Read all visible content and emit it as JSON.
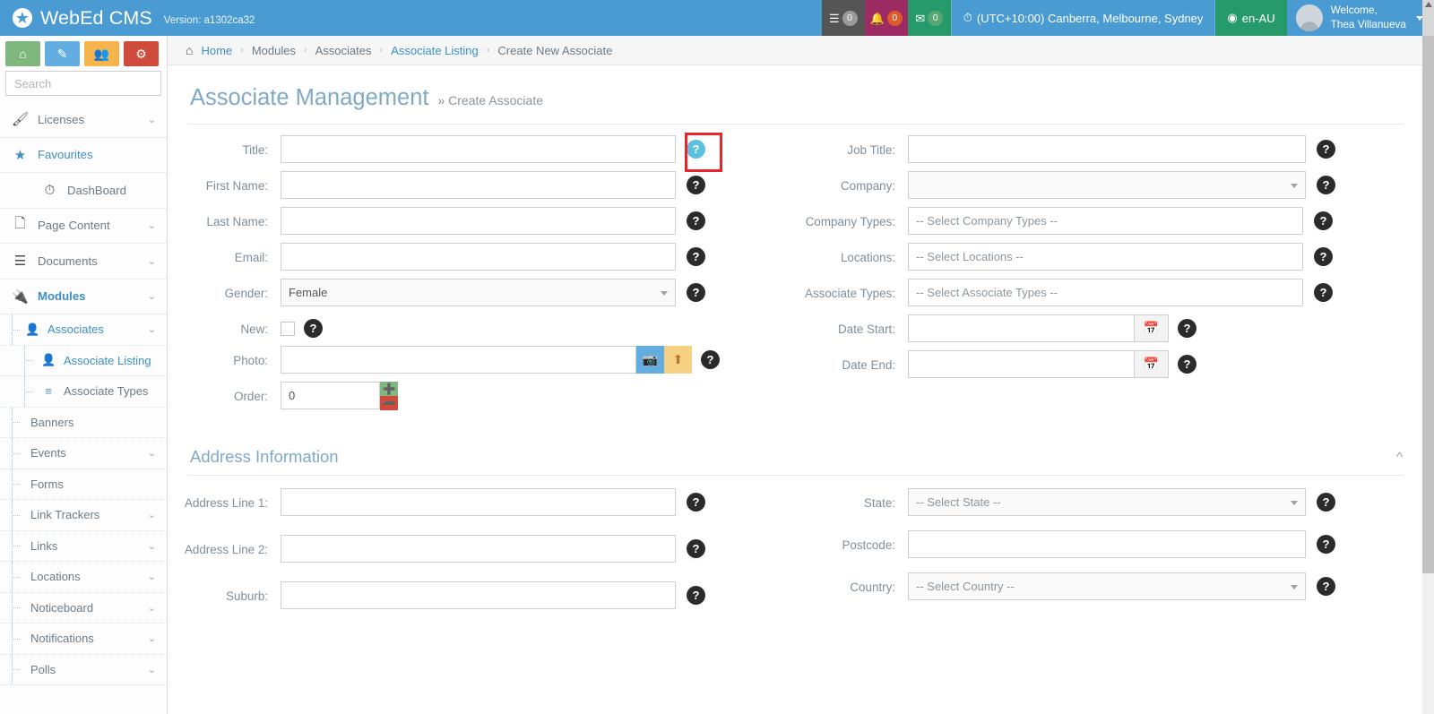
{
  "header": {
    "brand_name": "WebEd CMS",
    "brand_icon": "globe-icon",
    "version": "Version: a1302ca32",
    "tiles": [
      {
        "icon": "tasks-icon",
        "count": "0",
        "color": "#555555",
        "badge_color": "#9b9b9b"
      },
      {
        "icon": "bell-icon",
        "count": "0",
        "color": "#9c2a63",
        "badge_color": "#e0592a"
      },
      {
        "icon": "envelope-icon",
        "count": "0",
        "color": "#279a6c",
        "badge_color": "#57a773"
      }
    ],
    "timezone": "(UTC+10:00) Canberra, Melbourne, Sydney",
    "timezone_icon": "clock-icon",
    "language": "en-AU",
    "language_icon": "globe-small-icon",
    "welcome_line1": "Welcome,",
    "welcome_line2": "Thea Villanueva"
  },
  "sidebar": {
    "quick_actions": [
      {
        "name": "home",
        "icon": "home-icon",
        "color": "#7fb77e"
      },
      {
        "name": "edit",
        "icon": "pencil-icon",
        "color": "#63ade0"
      },
      {
        "name": "users",
        "icon": "users-icon",
        "color": "#f5b44c"
      },
      {
        "name": "settings",
        "icon": "gears-icon",
        "color": "#cf4b3c"
      }
    ],
    "search_placeholder": "Search",
    "search_value": "",
    "search_icon": "search-icon",
    "items": [
      {
        "label": "Licenses",
        "icon": "brush-icon",
        "chevron": "⌄",
        "style": "plain"
      },
      {
        "label": "Favourites",
        "icon": "star-icon",
        "chevron": "",
        "style": "blue"
      },
      {
        "label": "DashBoard",
        "icon": "gauge-icon",
        "chevron": "",
        "style": "plain"
      },
      {
        "label": "Page Content",
        "icon": "document-icon",
        "chevron": "⌄",
        "style": "plain"
      },
      {
        "label": "Documents",
        "icon": "lines-icon",
        "chevron": "⌄",
        "style": "plain"
      },
      {
        "label": "Modules",
        "icon": "plug-icon",
        "chevron": "⌄",
        "style": "blue-bold"
      }
    ],
    "sub_items": [
      {
        "label": "Associates",
        "icon": "associate-icon",
        "chevron": "⌄",
        "level": 1,
        "active": true
      },
      {
        "label": "Associate Listing",
        "icon": "associate-icon",
        "chevron": "",
        "level": 2,
        "active": true
      },
      {
        "label": "Associate Types",
        "icon": "list-icon",
        "chevron": "",
        "level": 2,
        "active": false
      },
      {
        "label": "Banners",
        "icon": "",
        "chevron": "",
        "level": 1,
        "active": false
      },
      {
        "label": "Events",
        "icon": "",
        "chevron": "⌄",
        "level": 1,
        "active": false
      },
      {
        "label": "Forms",
        "icon": "",
        "chevron": "",
        "level": 1,
        "active": false
      },
      {
        "label": "Link Trackers",
        "icon": "",
        "chevron": "⌄",
        "level": 1,
        "active": false
      },
      {
        "label": "Links",
        "icon": "",
        "chevron": "⌄",
        "level": 1,
        "active": false
      },
      {
        "label": "Locations",
        "icon": "",
        "chevron": "⌄",
        "level": 1,
        "active": false
      },
      {
        "label": "Noticeboard",
        "icon": "",
        "chevron": "⌄",
        "level": 1,
        "active": false
      },
      {
        "label": "Notifications",
        "icon": "",
        "chevron": "⌄",
        "level": 1,
        "active": false
      },
      {
        "label": "Polls",
        "icon": "",
        "chevron": "⌄",
        "level": 1,
        "active": false
      }
    ]
  },
  "breadcrumb": {
    "home_icon": "home-icon",
    "items": [
      {
        "label": "Home",
        "link": true
      },
      {
        "label": "Modules",
        "link": false
      },
      {
        "label": "Associates",
        "link": false
      },
      {
        "label": "Associate Listing",
        "link": true
      },
      {
        "label": "Create New Associate",
        "link": false
      }
    ],
    "separator": "›"
  },
  "page": {
    "title": "Associate Management",
    "subtitle": "» Create Associate"
  },
  "form": {
    "help_icon": "question-mark-icon",
    "left": [
      {
        "label": "Title:",
        "type": "text",
        "value": "",
        "placeholder": "",
        "width": "w441",
        "help": true,
        "highlighted": true
      },
      {
        "label": "First Name:",
        "type": "text",
        "value": "",
        "placeholder": "",
        "width": "w441",
        "help": true,
        "highlighted": false
      },
      {
        "label": "Last Name:",
        "type": "text",
        "value": "",
        "placeholder": "",
        "width": "w441",
        "help": true,
        "highlighted": false
      },
      {
        "label": "Email:",
        "type": "text",
        "value": "",
        "placeholder": "",
        "width": "w441",
        "help": true,
        "highlighted": false
      },
      {
        "label": "Gender:",
        "type": "select",
        "value": "Female",
        "width": "w441",
        "help": true,
        "highlighted": false
      },
      {
        "label": "New:",
        "type": "checkbox",
        "checked": false,
        "help": true,
        "highlighted": false
      },
      {
        "label": "Photo:",
        "type": "photo",
        "value": "",
        "width": "w397",
        "help": true,
        "highlighted": false,
        "browse_icon": "image-icon",
        "upload_icon": "upload-icon"
      },
      {
        "label": "Order:",
        "type": "stepper",
        "value": "0",
        "width": "w111",
        "help": false,
        "highlighted": false,
        "plus": "+",
        "minus": "−"
      }
    ],
    "right": [
      {
        "label": "Job Title:",
        "type": "text",
        "value": "",
        "placeholder": "",
        "width": "w444",
        "help": true
      },
      {
        "label": "Company:",
        "type": "select",
        "value": "",
        "width": "w444",
        "help": true
      },
      {
        "label": "Company Types:",
        "type": "multiselect",
        "value": "-- Select Company Types --",
        "width": "w441",
        "help": true
      },
      {
        "label": "Locations:",
        "type": "multiselect",
        "value": "-- Select Locations --",
        "width": "w441",
        "help": true
      },
      {
        "label": "Associate Types:",
        "type": "multiselect",
        "value": "-- Select Associate Types --",
        "width": "w441",
        "help": true
      },
      {
        "label": "Date Start:",
        "type": "date",
        "value": "",
        "width": "w253",
        "help": true,
        "calendar_icon": "calendar-icon"
      },
      {
        "label": "Date End:",
        "type": "date",
        "value": "",
        "width": "w253",
        "help": true,
        "calendar_icon": "calendar-icon"
      }
    ]
  },
  "address_section": {
    "title": "Address Information",
    "collapse_icon": "chevron-up-icon",
    "left": [
      {
        "label": "Address Line 1:",
        "type": "text",
        "value": "",
        "width": "w441",
        "help": true
      },
      {
        "label": "Address Line 2:",
        "type": "text",
        "value": "",
        "width": "w441",
        "help": true
      },
      {
        "label": "Suburb:",
        "type": "text",
        "value": "",
        "width": "w441",
        "help": true
      }
    ],
    "right": [
      {
        "label": "State:",
        "type": "select",
        "value": "-- Select State --",
        "width": "w444",
        "help": true
      },
      {
        "label": "Postcode:",
        "type": "text",
        "value": "",
        "width": "w444",
        "help": true
      },
      {
        "label": "Country:",
        "type": "select",
        "value": "-- Select Country --",
        "width": "w444",
        "help": true
      }
    ]
  },
  "colors": {
    "brand_blue": "#4a9bd1",
    "accent_link": "#3d8fc4",
    "title_blue": "#7fa9c9",
    "highlight_red": "#e8252a",
    "help_highlight": "#5bc0de"
  }
}
